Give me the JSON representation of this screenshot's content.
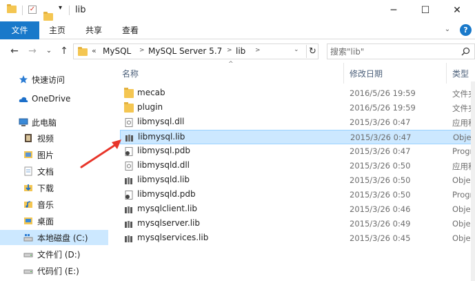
{
  "window": {
    "title": "lib",
    "minimize_glyph": "─",
    "maximize_glyph": "☐",
    "close_glyph": "✕"
  },
  "ribbon": {
    "tabs": [
      "文件",
      "主页",
      "共享",
      "查看"
    ],
    "help_glyph": "?",
    "collapse_glyph": "⌄"
  },
  "address": {
    "overflow_glyph": "«",
    "crumbs": [
      "MySQL",
      "MySQL Server 5.7",
      "lib"
    ],
    "search_placeholder": "搜索\"lib\"",
    "refresh_glyph": "↻",
    "dropdown_glyph": "⌄"
  },
  "nav_buttons": {
    "back": "←",
    "forward": "→",
    "recent": "⌄",
    "up": "↑"
  },
  "nav_pane": {
    "items": [
      {
        "label": "快速访问",
        "icon": "star-icon",
        "indent": 0
      },
      {
        "label": "OneDrive",
        "icon": "cloud-icon",
        "indent": 0
      },
      {
        "label": "此电脑",
        "icon": "computer-icon",
        "indent": 0
      },
      {
        "label": "视频",
        "icon": "video-folder-icon",
        "indent": 1
      },
      {
        "label": "图片",
        "icon": "pictures-folder-icon",
        "indent": 1
      },
      {
        "label": "文档",
        "icon": "documents-folder-icon",
        "indent": 1
      },
      {
        "label": "下载",
        "icon": "downloads-folder-icon",
        "indent": 1
      },
      {
        "label": "音乐",
        "icon": "music-folder-icon",
        "indent": 1
      },
      {
        "label": "桌面",
        "icon": "desktop-folder-icon",
        "indent": 1
      },
      {
        "label": "本地磁盘 (C:)",
        "icon": "drive-icon",
        "indent": 1,
        "selected": true
      },
      {
        "label": "文件们 (D:)",
        "icon": "drive-icon",
        "indent": 1
      },
      {
        "label": "代码们 (E:)",
        "icon": "drive-icon",
        "indent": 1
      }
    ]
  },
  "file_list": {
    "columns": {
      "name": "名称",
      "date": "修改日期",
      "type": "类型"
    },
    "sort_glyph": "^",
    "rows": [
      {
        "name": "mecab",
        "date": "2016/5/26 19:59",
        "type": "文件夹",
        "icon": "folder-icon"
      },
      {
        "name": "plugin",
        "date": "2016/5/26 19:59",
        "type": "文件夹",
        "icon": "folder-icon"
      },
      {
        "name": "libmysql.dll",
        "date": "2015/3/26 0:47",
        "type": "应用程序扩展",
        "icon": "dll-file-icon"
      },
      {
        "name": "libmysql.lib",
        "date": "2015/3/26 0:47",
        "type": "Object File Library",
        "icon": "lib-file-icon",
        "selected": true
      },
      {
        "name": "libmysql.pdb",
        "date": "2015/3/26 0:47",
        "type": "Program Debug Database",
        "icon": "pdb-file-icon"
      },
      {
        "name": "libmysqld.dll",
        "date": "2015/3/26 0:50",
        "type": "应用程序扩展",
        "icon": "dll-file-icon"
      },
      {
        "name": "libmysqld.lib",
        "date": "2015/3/26 0:50",
        "type": "Object File Library",
        "icon": "lib-file-icon"
      },
      {
        "name": "libmysqld.pdb",
        "date": "2015/3/26 0:50",
        "type": "Program Debug Database",
        "icon": "pdb-file-icon"
      },
      {
        "name": "mysqlclient.lib",
        "date": "2015/3/26 0:46",
        "type": "Object File Library",
        "icon": "lib-file-icon"
      },
      {
        "name": "mysqlserver.lib",
        "date": "2015/3/26 0:49",
        "type": "Object File Library",
        "icon": "lib-file-icon"
      },
      {
        "name": "mysqlservices.lib",
        "date": "2015/3/26 0:45",
        "type": "Object File Library",
        "icon": "lib-file-icon"
      }
    ]
  },
  "colors": {
    "accent": "#1979ca",
    "selection_bg": "#cce8ff",
    "selection_border": "#99d1ff",
    "annotation_arrow": "#e8352a"
  }
}
